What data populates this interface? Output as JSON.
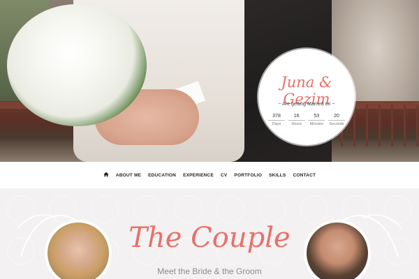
{
  "hero": {
    "names": "Juna & Gezim",
    "subtitle": "~ Are getting Married on ~",
    "countdown": [
      {
        "value": "378",
        "label": "Days"
      },
      {
        "value": "16",
        "label": "Hours"
      },
      {
        "value": "53",
        "label": "Minutes"
      },
      {
        "value": "20",
        "label": "Seconds"
      }
    ]
  },
  "nav": {
    "home_icon": "home-icon",
    "items": [
      "ABOUT ME",
      "EDUCATION",
      "EXPERIENCE",
      "CV",
      "PORTFOLIO",
      "SKILLS",
      "CONTACT"
    ]
  },
  "couple": {
    "title": "The Couple",
    "subtitle": "Meet the Bride & the Groom"
  },
  "colors": {
    "accent": "#e8706a",
    "nav_text": "#222222",
    "section_bg": "#f3f1f1"
  }
}
